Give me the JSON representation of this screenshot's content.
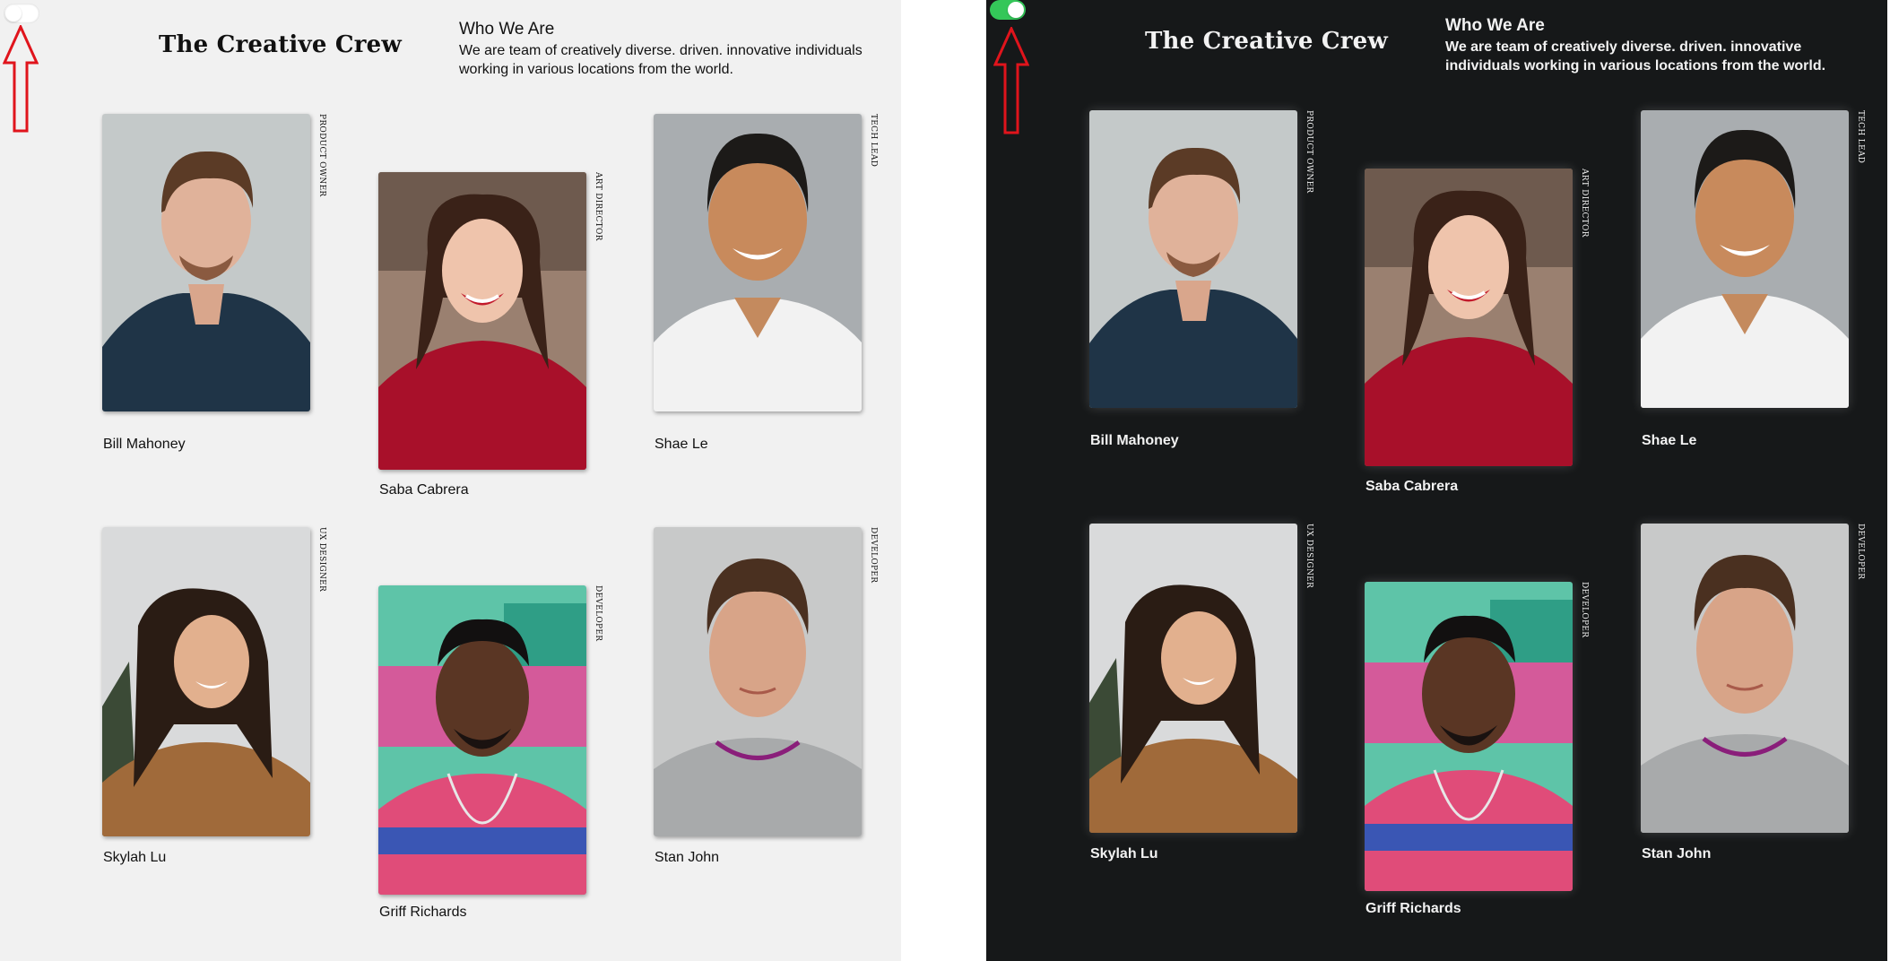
{
  "header": {
    "title": "The Creative Crew",
    "who_title": "Who We Are",
    "who_text": "We are team of creatively diverse. driven. innovative individuals working in various locations from the world."
  },
  "toggle": {
    "light_state": "off",
    "dark_state": "on",
    "on_color": "#34c759"
  },
  "theme": {
    "light_background": "#f1f1f1",
    "dark_background": "#161819"
  },
  "annotation": {
    "arrow_color": "#e0141c",
    "icon": "up-arrow-icon"
  },
  "team": [
    {
      "name": "Bill Mahoney",
      "role": "PRODUCT OWNER"
    },
    {
      "name": "Saba Cabrera",
      "role": "ART DIRECTOR"
    },
    {
      "name": "Shae Le",
      "role": "TECH LEAD"
    },
    {
      "name": "Skylah Lu",
      "role": "UX DESIGNER"
    },
    {
      "name": "Griff Richards",
      "role": "DEVELOPER"
    },
    {
      "name": "Stan John",
      "role": "DEVELOPER"
    }
  ]
}
